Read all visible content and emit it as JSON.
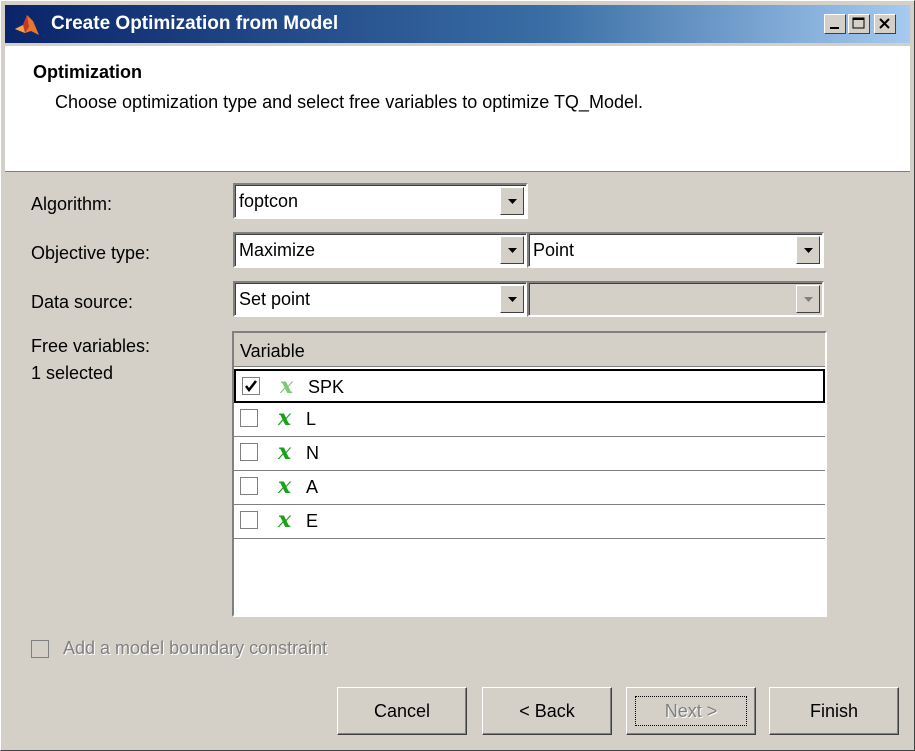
{
  "window": {
    "title": "Create Optimization from Model"
  },
  "header": {
    "title": "Optimization",
    "description": "Choose optimization type and select free variables to optimize TQ_Model."
  },
  "form": {
    "algorithm_label": "Algorithm:",
    "algorithm_value": "foptcon",
    "objective_label": "Objective type:",
    "objective_value": "Maximize",
    "objective_mode": "Point",
    "datasource_label": "Data source:",
    "datasource_value": "Set point",
    "datasource_secondary": "",
    "freevars_label": "Free variables:",
    "freevars_count": "1 selected"
  },
  "table": {
    "column_header": "Variable",
    "rows": [
      {
        "name": "SPK",
        "checked": true
      },
      {
        "name": "L",
        "checked": false
      },
      {
        "name": "N",
        "checked": false
      },
      {
        "name": "A",
        "checked": false
      },
      {
        "name": "E",
        "checked": false
      }
    ],
    "icon_glyph": "x"
  },
  "boundary_checkbox_label": "Add a model boundary constraint",
  "buttons": {
    "cancel": "Cancel",
    "back": "< Back",
    "next": "Next >",
    "finish": "Finish"
  },
  "colors": {
    "title_gradient_start": "#0a246a",
    "title_gradient_end": "#a6caf0",
    "variable_icon": "#1aa01a",
    "dialog_bg": "#d4d0c8"
  },
  "icons": {
    "app": "matlab-membrane-icon",
    "minimize": "minimize-icon",
    "maximize": "maximize-icon",
    "close": "close-icon",
    "dropdown": "chevron-down-icon",
    "checkmark": "checkmark-icon",
    "variable": "variable-x-icon"
  }
}
